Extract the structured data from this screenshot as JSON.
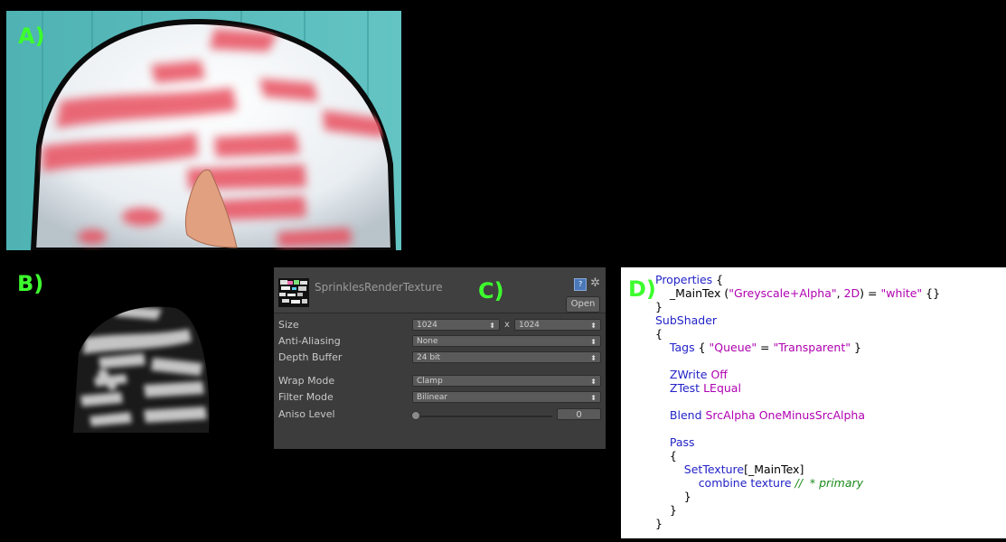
{
  "labels": {
    "a": "A)",
    "b": "B)",
    "c": "C)",
    "d": "D)"
  },
  "inspector": {
    "title": "SprinklesRenderTexture",
    "open_button": "Open",
    "rows": [
      {
        "label": "Size",
        "value": "1024",
        "value2": "1024",
        "separator": "x"
      },
      {
        "label": "Anti-Aliasing",
        "value": "None"
      },
      {
        "label": "Depth Buffer",
        "value": "24 bit"
      },
      {
        "label": "Wrap Mode",
        "value": "Clamp"
      },
      {
        "label": "Filter Mode",
        "value": "Bilinear"
      },
      {
        "label": "Aniso Level",
        "value": "0",
        "slider_fraction": 0
      }
    ]
  },
  "code": {
    "lines": [
      "Properties {",
      "    _MainTex (\"Greyscale+Alpha\", 2D) = \"white\" {}",
      "}",
      "SubShader",
      "{",
      "    Tags { \"Queue\" = \"Transparent\" }",
      "",
      "    ZWrite Off",
      "    ZTest LEqual",
      "",
      "    Blend SrcAlpha OneMinusSrcAlpha",
      "",
      "    Pass",
      "    {",
      "        SetTexture[_MainTex]",
      "            combine texture //  * primary",
      "        }",
      "    }",
      "}"
    ]
  },
  "colors": {
    "label_green": "#3dff2e",
    "background_teal": "#5ab8b8",
    "stripe_red": "#e8505f",
    "code_keyword": "#2323c8",
    "code_string": "#b000b0",
    "code_comment": "#1a8a1a"
  }
}
